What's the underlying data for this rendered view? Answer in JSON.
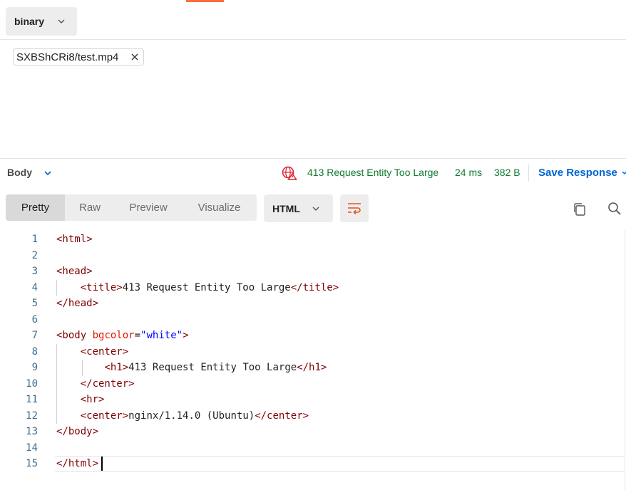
{
  "request": {
    "body_type": "binary",
    "file_name": "SXBShCRi8/test.mp4"
  },
  "response": {
    "body_label": "Body",
    "status": "413 Request Entity Too Large",
    "time": "24 ms",
    "size": "382 B",
    "save_label": "Save Response",
    "tabs": [
      "Pretty",
      "Raw",
      "Preview",
      "Visualize"
    ],
    "active_tab": "Pretty",
    "format": "HTML",
    "colors": {
      "status": "#0f7b2e",
      "accent": "#ff6c37",
      "link": "#0265d2"
    },
    "code_lines": [
      {
        "n": "1",
        "t": "<html>"
      },
      {
        "n": "2",
        "t": ""
      },
      {
        "n": "3",
        "t": "<head>"
      },
      {
        "n": "4",
        "t": "    <title>413 Request Entity Too Large</title>"
      },
      {
        "n": "5",
        "t": "</head>"
      },
      {
        "n": "6",
        "t": ""
      },
      {
        "n": "7",
        "t": "<body bgcolor=\"white\">"
      },
      {
        "n": "8",
        "t": "    <center>"
      },
      {
        "n": "9",
        "t": "        <h1>413 Request Entity Too Large</h1>"
      },
      {
        "n": "10",
        "t": "    </center>"
      },
      {
        "n": "11",
        "t": "    <hr>"
      },
      {
        "n": "12",
        "t": "    <center>nginx/1.14.0 (Ubuntu)</center>"
      },
      {
        "n": "13",
        "t": "</body>"
      },
      {
        "n": "14",
        "t": ""
      },
      {
        "n": "15",
        "t": "</html>"
      }
    ]
  },
  "icons": [
    "chevron-down-icon",
    "close-icon",
    "globe-error-icon",
    "wrap-lines-icon",
    "copy-icon",
    "search-icon"
  ]
}
